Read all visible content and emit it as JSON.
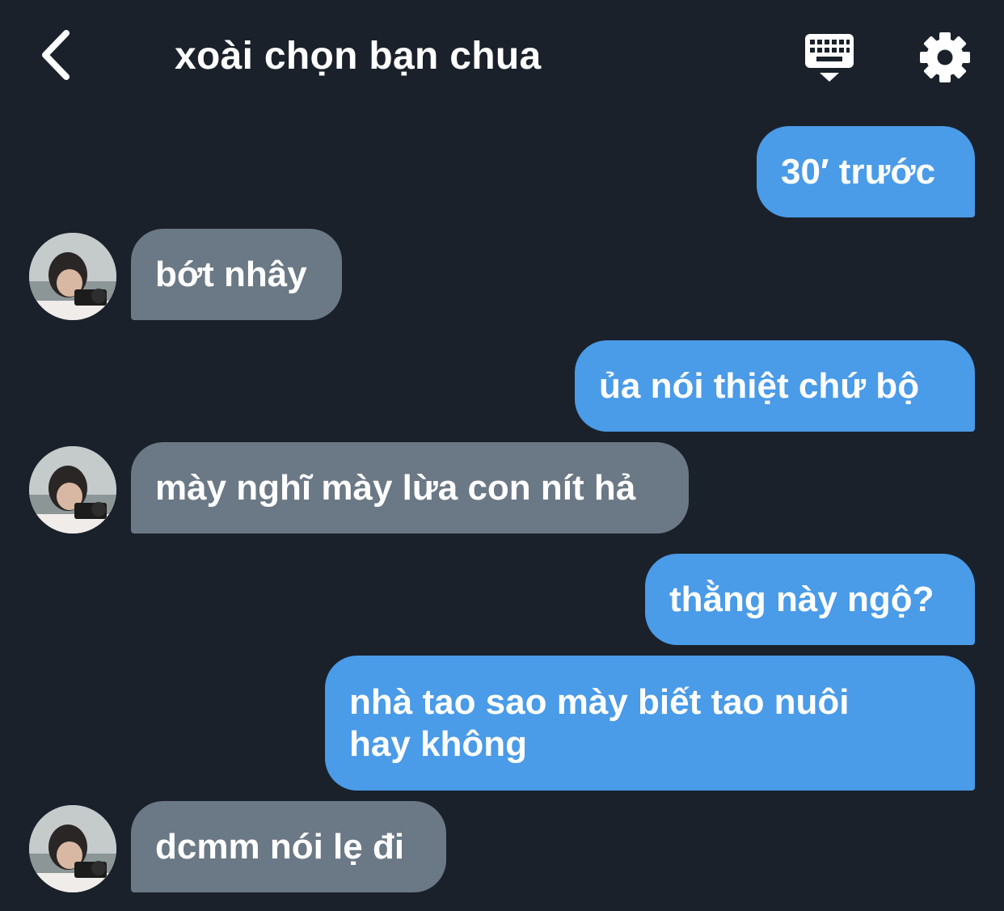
{
  "header": {
    "title": "xoài chọn bạn chua",
    "back_icon": "chevron-left-icon",
    "keyboard_icon": "keyboard-hide-icon",
    "settings_icon": "gear-icon"
  },
  "colors": {
    "background": "#1a212b",
    "sent_bubble": "#4a9be8",
    "received_bubble": "#6b7885",
    "text": "#ffffff"
  },
  "messages": [
    {
      "direction": "sent",
      "text": "30′ trước"
    },
    {
      "direction": "received",
      "text": "bớt nhây"
    },
    {
      "direction": "sent",
      "text": "ủa nói thiệt chứ bộ"
    },
    {
      "direction": "received",
      "text": "mày nghĩ mày lừa con nít hả"
    },
    {
      "direction": "sent",
      "text": "thằng này ngộ?"
    },
    {
      "direction": "sent",
      "text": "nhà tao sao mày biết tao nuôi hay không"
    },
    {
      "direction": "received",
      "text": "dcmm nói lẹ đi"
    }
  ]
}
